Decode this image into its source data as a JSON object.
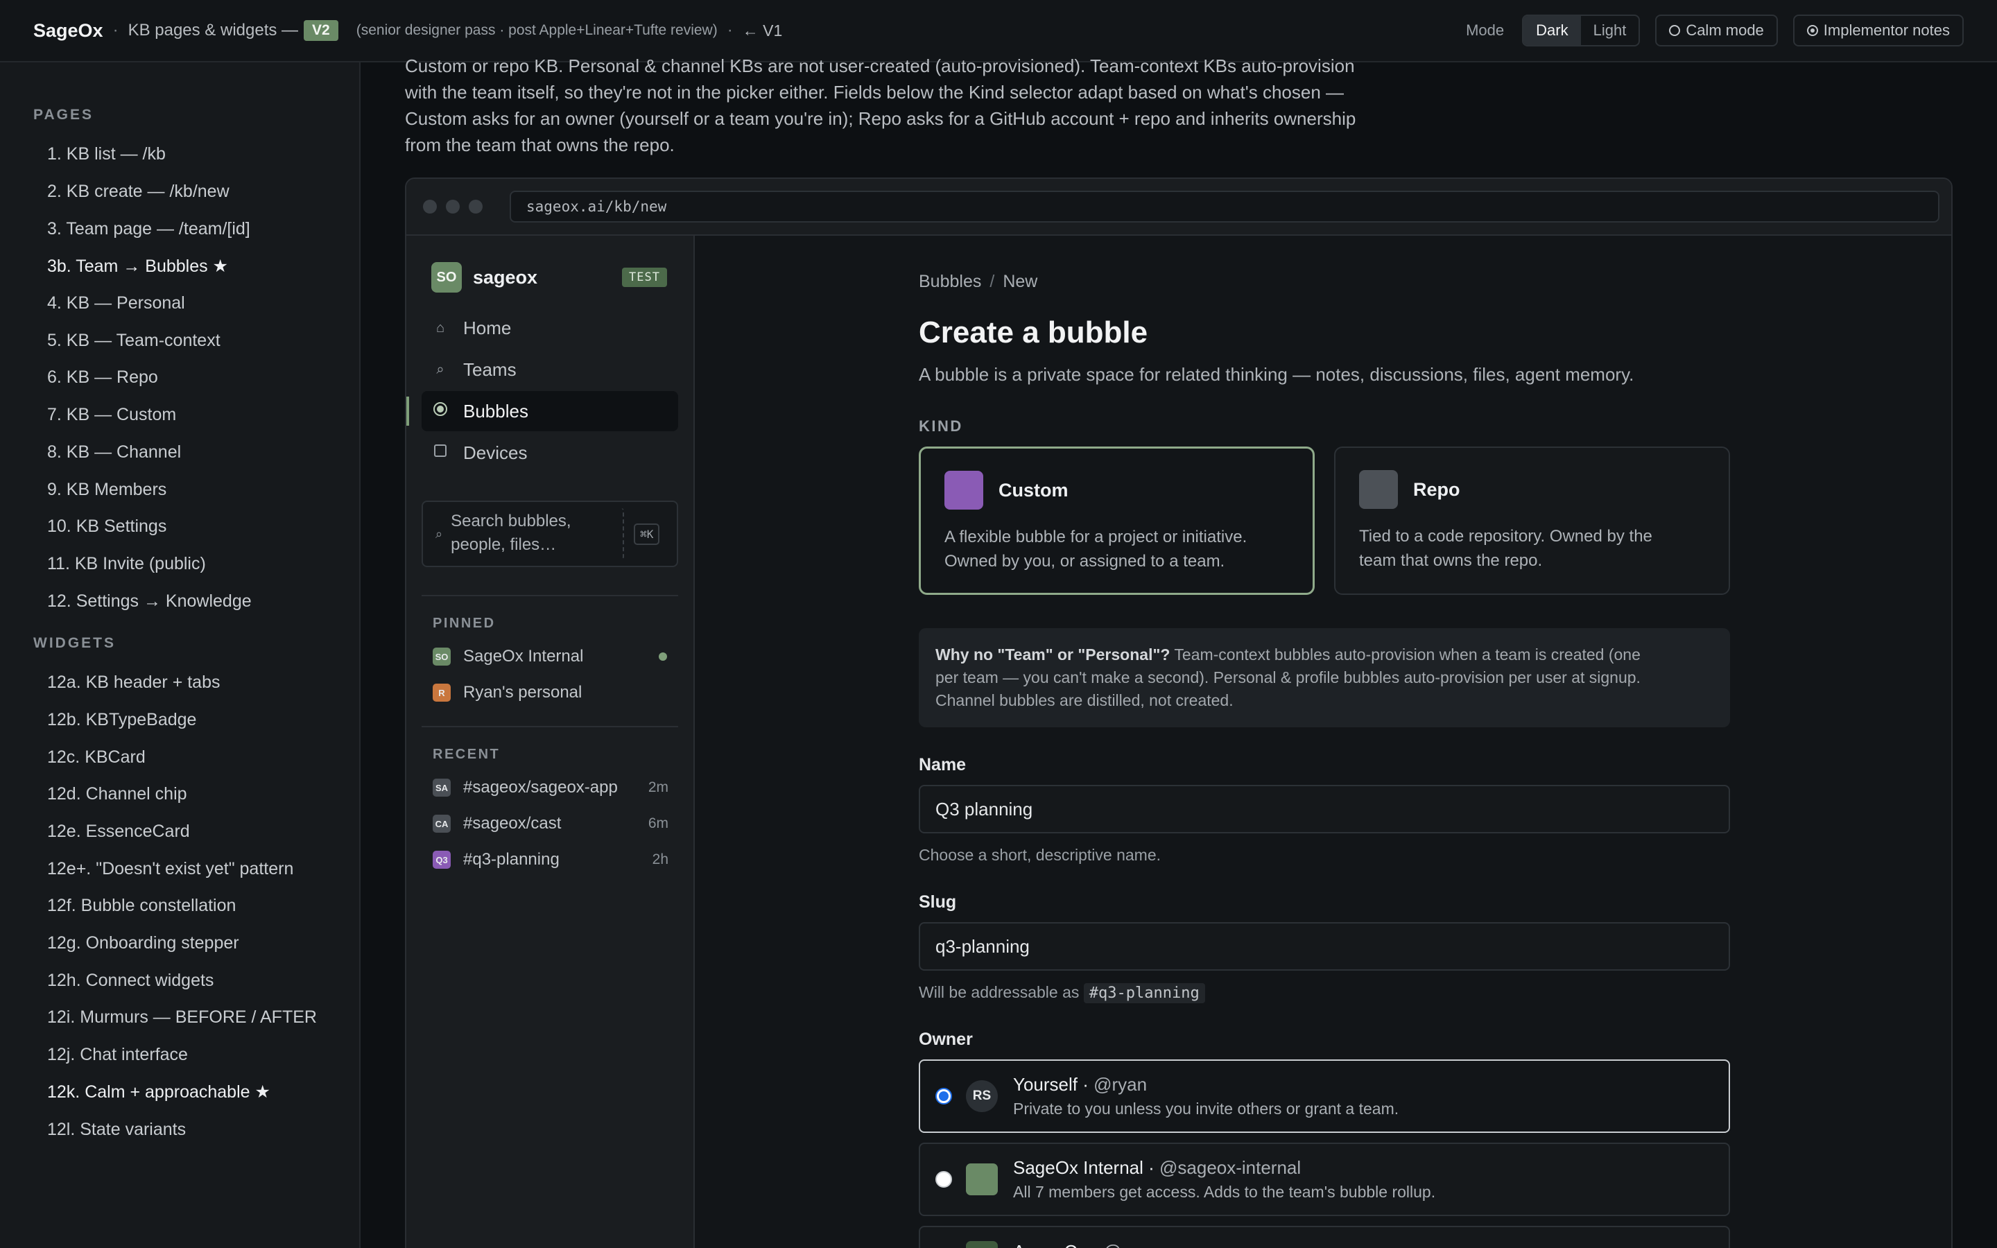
{
  "topbar": {
    "brand": "SageOx",
    "section": "KB pages & widgets —",
    "version_badge": "V2",
    "note": "(senior designer pass · post Apple+Linear+Tufte review)",
    "back_link": "← V1",
    "mode_label": "Mode",
    "mode_options": [
      "Dark",
      "Light"
    ],
    "mode_selected": "Dark",
    "calm_mode": "Calm mode",
    "implementor_notes": "Implementor notes"
  },
  "docnav": {
    "pages_heading": "PAGES",
    "pages": [
      "1. KB list — /kb",
      "2. KB create — /kb/new",
      "3. Team page — /team/[id]",
      "3b. Team → Bubbles ★",
      "4. KB — Personal",
      "5. KB — Team-context",
      "6. KB — Repo",
      "7. KB — Custom",
      "8. KB — Channel",
      "9. KB Members",
      "10. KB Settings",
      "11. KB Invite (public)",
      "12. Settings → Knowledge"
    ],
    "widgets_heading": "WIDGETS",
    "widgets": [
      "12a. KB header + tabs",
      "12b. KBTypeBadge",
      "12c. KBCard",
      "12d. Channel chip",
      "12e. EssenceCard",
      "12e+. \"Doesn't exist yet\" pattern",
      "12f. Bubble constellation",
      "12g. Onboarding stepper",
      "12h. Connect widgets",
      "12i. Murmurs — BEFORE / AFTER",
      "12j. Chat interface",
      "12k. Calm + approachable ★",
      "12l. State variants"
    ]
  },
  "intro": {
    "lines": [
      "Custom or repo KB. Personal & channel KBs are not user-created (auto-provisioned). Team-context KBs auto-provision",
      "with the team itself, so they're not in the picker either. Fields below the Kind selector adapt based on what's chosen —",
      "Custom asks for an owner (yourself or a team you're in); Repo asks for a GitHub account + repo and inherits ownership",
      "from the team that owns the repo."
    ]
  },
  "browser": {
    "url": "sageox.ai/kb/new"
  },
  "app": {
    "workspace": {
      "avatar": "SO",
      "name": "sageox",
      "badge": "TEST"
    },
    "nav": [
      {
        "icon": "home-icon",
        "glyph": "⌂",
        "label": "Home"
      },
      {
        "icon": "teams-icon",
        "glyph": "⌕",
        "label": "Teams"
      },
      {
        "icon": "bubble-icon",
        "glyph": "",
        "label": "Bubbles"
      },
      {
        "icon": "devices-icon",
        "glyph": "",
        "label": "Devices"
      }
    ],
    "nav_active": "Bubbles",
    "search": {
      "placeholder": "Search bubbles, people, files…",
      "shortcut": "⌘K"
    },
    "pinned_heading": "PINNED",
    "pinned": [
      {
        "chip": "SO",
        "chip_color": "#6a8a66",
        "label": "SageOx Internal",
        "online": true
      },
      {
        "chip": "R",
        "chip_color": "#c9773e",
        "label": "Ryan's personal",
        "online": false
      }
    ],
    "recent_heading": "RECENT",
    "recent": [
      {
        "chip": "SA",
        "chip_color": "#4a4f55",
        "label": "#sageox/sageox-app",
        "age": "2m"
      },
      {
        "chip": "CA",
        "chip_color": "#4a4f55",
        "label": "#sageox/cast",
        "age": "6m"
      },
      {
        "chip": "Q3",
        "chip_color": "#8a5bb5",
        "label": "#q3-planning",
        "age": "2h"
      }
    ]
  },
  "form": {
    "breadcrumb": [
      "Bubbles",
      "New"
    ],
    "title": "Create a bubble",
    "lede": "A bubble is a private space for related thinking — notes, discussions, files, agent memory.",
    "kind_label": "KIND",
    "kinds": [
      {
        "name": "Custom",
        "color": "#8a5bb5",
        "desc_1": "A flexible bubble for a project or initiative.",
        "desc_2": "Owned by you, or assigned to a team.",
        "selected": true
      },
      {
        "name": "Repo",
        "color": "#4c5157",
        "desc_1": "Tied to a code repository. Owned by the",
        "desc_2": "team that owns the repo.",
        "selected": false
      }
    ],
    "why": {
      "strong": "Why no \"Team\" or \"Personal\"?",
      "text_1": " Team-context bubbles auto-provision when a team is created (one",
      "text_2": "per team — you can't make a second). Personal & profile bubbles auto-provision per user at signup.",
      "text_3": "Channel bubbles are distilled, not created."
    },
    "name_label": "Name",
    "name_value": "Q3 planning",
    "name_help": "Choose a short, descriptive name.",
    "slug_label": "Slug",
    "slug_value": "q3-planning",
    "slug_help": "Will be addressable as",
    "slug_handle": "#q3-planning",
    "owner_label": "Owner",
    "owners": [
      {
        "avatar": "RS",
        "name": "Yourself",
        "handle": "@ryan",
        "sub": "Private to you unless you invite others or grant a team.",
        "selected": true
      },
      {
        "avatar": "",
        "name": "SageOx Internal",
        "handle": "@sageox-internal",
        "sub": "All 7 members get access. Adds to the team's bubble rollup.",
        "selected": false
      },
      {
        "avatar": "",
        "name": "Acme Co",
        "handle": "@acme-co",
        "sub": "",
        "selected": false
      }
    ]
  }
}
